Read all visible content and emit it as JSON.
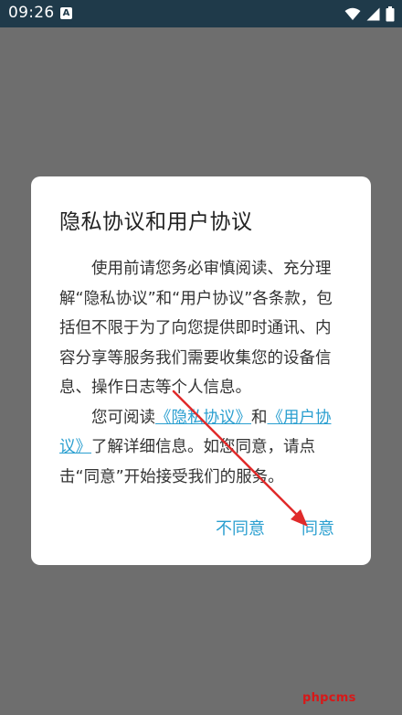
{
  "status_bar": {
    "time": "09:26",
    "app_icon_letter": "A"
  },
  "dialog": {
    "title": "隐私协议和用户协议",
    "paragraph1": "使用前请您务必审慎阅读、充分理解“隐私协议”和“用户协议”各条款，包括但不限于为了向您提供即时通讯、内容分享等服务我们需要收集您的设备信息、操作日志等个人信息。",
    "paragraph2": {
      "text_before": "您可阅读",
      "link_privacy": "《隐私协议》",
      "text_and": "和",
      "link_user": "《用户协议》",
      "text_after": "了解详细信息。如您同意，请点击“同意”开始接受我们的服务。"
    },
    "buttons": {
      "disagree": "不同意",
      "agree": "同意"
    }
  },
  "colors": {
    "status_bar": "#1f3a4a",
    "overlay": "#6e6e6e",
    "link": "#2a9fd0",
    "annotation_arrow": "#e02a2a"
  },
  "watermark": "phpcms"
}
